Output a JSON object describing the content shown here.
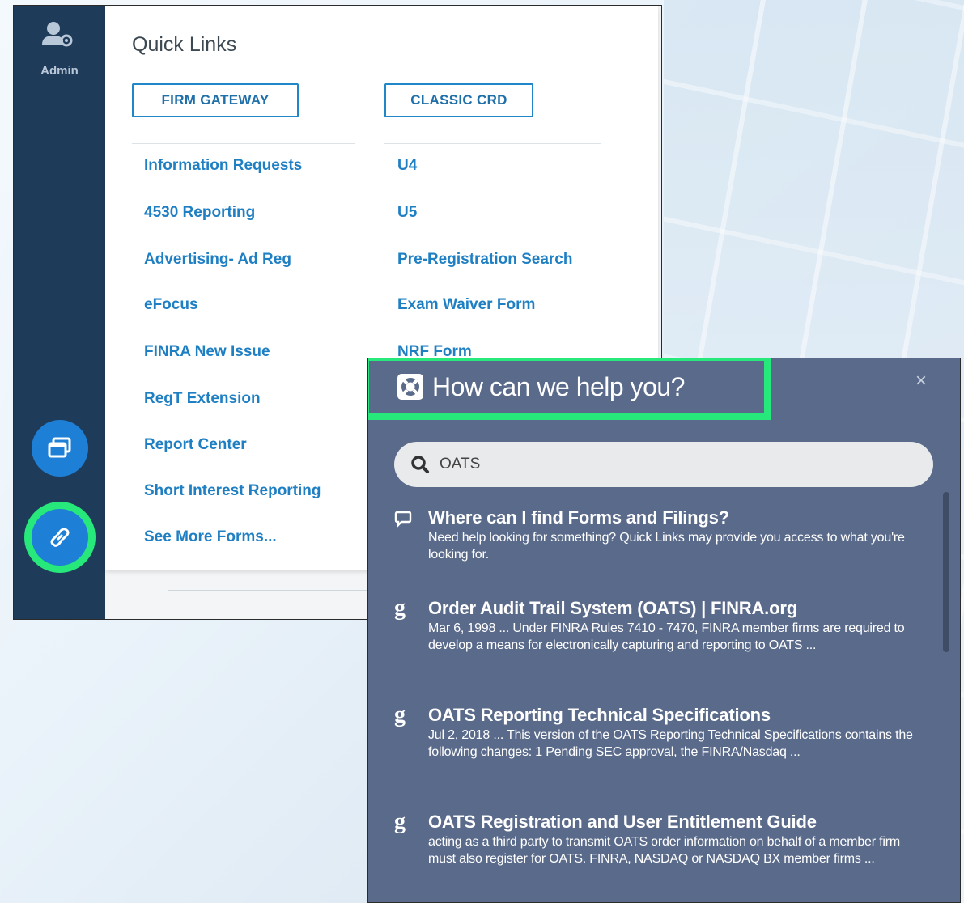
{
  "sidebar": {
    "admin_label": "Admin"
  },
  "quick_links": {
    "title": "Quick Links",
    "firm_gateway_button": "FIRM GATEWAY",
    "classic_crd_button": "CLASSIC CRD",
    "left_links": [
      "Information Requests",
      "4530 Reporting",
      "Advertising- Ad Reg",
      "eFocus",
      "FINRA New Issue",
      "RegT Extension",
      "Report Center",
      "Short Interest Reporting",
      "See More Forms..."
    ],
    "right_links": [
      "U4",
      "U5",
      "Pre-Registration Search",
      "Exam Waiver Form",
      "NRF Form"
    ]
  },
  "help": {
    "title": "How can we help you?",
    "close_symbol": "×",
    "search_value": "OATS",
    "results": [
      {
        "icon": "chat-bubble-icon",
        "title": "Where can I find Forms and Filings?",
        "snippet": "Need help looking for something? Quick Links may provide you access to what you're looking for."
      },
      {
        "icon": "google-g-icon",
        "title": "Order Audit Trail System (OATS) | FINRA.org",
        "snippet": "Mar 6, 1998 ... Under FINRA Rules 7410 - 7470, FINRA member firms are required to develop a means for electronically capturing and reporting to OATS ..."
      },
      {
        "icon": "google-g-icon",
        "title": "OATS Reporting Technical Specifications",
        "snippet": "Jul 2, 2018 ... This version of the OATS Reporting Technical Specifications contains the following changes: 1 Pending SEC approval, the FINRA/Nasdaq ..."
      },
      {
        "icon": "google-g-icon",
        "title": "OATS Registration and User Entitlement Guide",
        "snippet": "acting as a third party to transmit OATS order information on behalf of a member firm must also register for OATS. FINRA, NASDAQ or NASDAQ BX member firms ..."
      }
    ]
  },
  "colors": {
    "sidebar": "#1f3b5a",
    "link": "#1f7fc3",
    "highlight": "#27e87a",
    "help_panel": "#5a6a8a"
  }
}
